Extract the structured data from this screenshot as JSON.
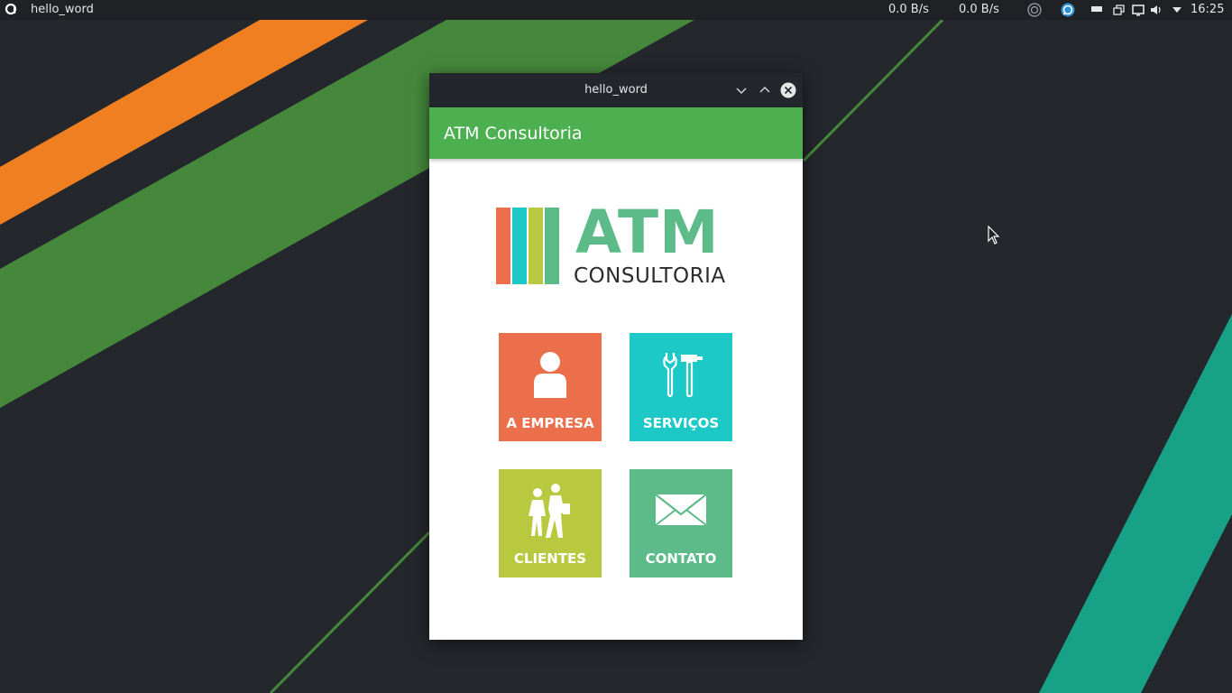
{
  "panel": {
    "active_window_title": "hello_word",
    "net_down": "0.0 B/s",
    "net_up": "0.0 B/s",
    "clock": "16:25",
    "tray_icons": [
      "network-circle-icon",
      "chat-icon",
      "window-manager-icon",
      "clipboard-icon",
      "display-icon",
      "volume-icon",
      "dropdown-arrow-icon"
    ]
  },
  "window": {
    "title": "hello_word",
    "buttons": [
      "minimize",
      "maximize",
      "close"
    ]
  },
  "app": {
    "appbar_title": "ATM Consultoria",
    "logo": {
      "main": "ATM",
      "sub": "CONSULTORIA",
      "bar_colors": [
        "#ec6f4c",
        "#1cc9c6",
        "#b8c93f",
        "#5dbb8a"
      ]
    },
    "tiles": [
      {
        "label": "A EMPRESA",
        "icon": "person-icon",
        "color": "#ec6f4c"
      },
      {
        "label": "SERVIÇOS",
        "icon": "tools-icon",
        "color": "#1cc9c6"
      },
      {
        "label": "CLIENTES",
        "icon": "people-walking-icon",
        "color": "#b8c93f"
      },
      {
        "label": "CONTATO",
        "icon": "envelope-icon",
        "color": "#5dbb8a"
      }
    ]
  },
  "colors": {
    "appbar_green": "#4caf50",
    "desktop_bg": "#24272c",
    "stripe_orange": "#f07f22",
    "stripe_green": "#45883b",
    "stripe_teal": "#17a187"
  }
}
